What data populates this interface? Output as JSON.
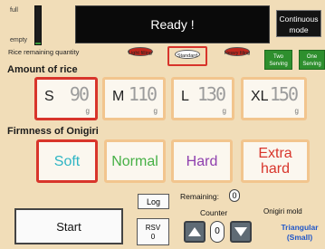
{
  "gauge": {
    "full_label": "full",
    "empty_label": "empty",
    "remaining_label": "Rice remaining quantity",
    "fill_fraction": 0.05
  },
  "status": {
    "text": "Ready !"
  },
  "mode_button": {
    "line1": "Continuous",
    "line2": "mode"
  },
  "rice_type": {
    "options": [
      {
        "label": "Light filling",
        "selected": false
      },
      {
        "label": "Standard",
        "selected": true
      },
      {
        "label": "Heavy filing",
        "selected": false
      }
    ]
  },
  "serving": {
    "two": {
      "line1": "Two",
      "line2": "Serving"
    },
    "one": {
      "line1": "One",
      "line2": "Serving"
    }
  },
  "amount": {
    "title": "Amount of rice",
    "options": [
      {
        "size": "S",
        "grams": "90",
        "unit": "g",
        "selected": true
      },
      {
        "size": "M",
        "grams": "110",
        "unit": "g",
        "selected": false
      },
      {
        "size": "L",
        "grams": "130",
        "unit": "g",
        "selected": false
      },
      {
        "size": "XL",
        "grams": "150",
        "unit": "g",
        "selected": false
      }
    ]
  },
  "firmness": {
    "title": "Firmness of Onigiri",
    "options": [
      {
        "label": "Soft",
        "selected": true
      },
      {
        "label": "Normal",
        "selected": false
      },
      {
        "label": "Hard",
        "selected": false
      },
      {
        "label": "Extra hard",
        "selected": false
      }
    ]
  },
  "controls": {
    "start_label": "Start",
    "log_label": "Log",
    "rsv_label": "RSV",
    "rsv_value": "0",
    "remaining_label": "Remaining:",
    "remaining_value": "0",
    "counter_label": "Counter",
    "counter_value": "0",
    "up_icon": "triangle-up-icon",
    "down_icon": "triangle-down-icon"
  },
  "mold": {
    "label": "Onigiri mold",
    "value_line1": "Triangular",
    "value_line2": "(Small)"
  },
  "colors": {
    "background": "#f1ddb8",
    "selected_border": "#d8352b",
    "unselected_border": "#f2c58e",
    "soft": "#2fb5c4",
    "normal": "#46b046",
    "hard": "#8e3fae",
    "extra_hard": "#d8352b",
    "serving_green": "#2e8f2e"
  }
}
